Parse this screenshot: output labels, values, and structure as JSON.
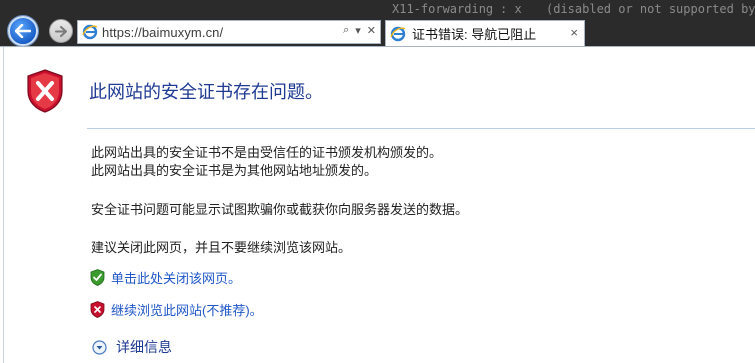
{
  "background_terminal": {
    "fragment_1": "X11-forwarding",
    "fragment_2": ": x",
    "fragment_3": "(disabled or not supported by se"
  },
  "browser": {
    "url": "https://baimuxym.cn/",
    "tab_title": "证书错误: 导航已阻止",
    "tab_close": "×",
    "address_tools": [
      "⌕",
      "▾",
      "✕"
    ]
  },
  "page": {
    "heading": "此网站的安全证书存在问题。",
    "messages": [
      "此网站出具的安全证书不是由受信任的证书颁发机构颁发的。",
      "此网站出具的安全证书是为其他网站地址颁发的。",
      "安全证书问题可能显示试图欺骗你或截获你向服务器发送的数据。",
      "建议关闭此网页，并且不要继续浏览该网站。"
    ],
    "actions": {
      "close_page": "单击此处关闭该网页。",
      "continue": "继续浏览此网站(不推荐)。"
    },
    "details": "详细信息"
  },
  "colors": {
    "heading": "#1f3a93",
    "link": "#1f57c8",
    "shield_red": "#c8102e",
    "shield_green": "#3a9a2e"
  }
}
